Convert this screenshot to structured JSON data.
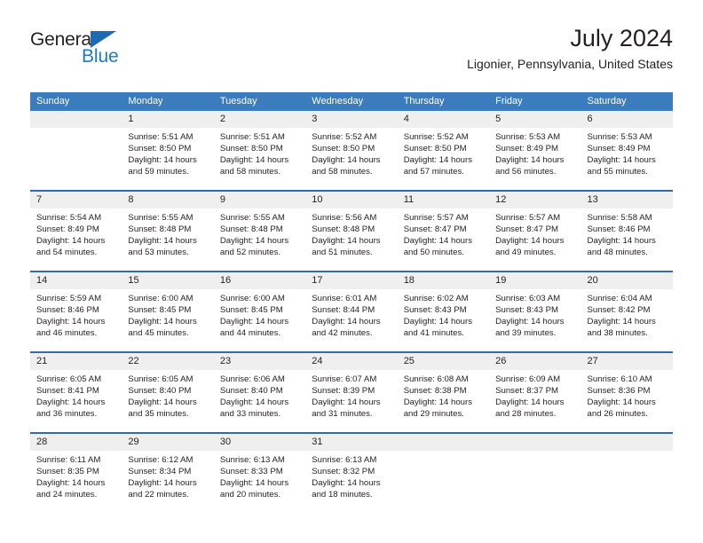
{
  "brand": {
    "name_top": "General",
    "name_bottom": "Blue",
    "color_dark": "#231f20",
    "color_blue": "#1f7ac4"
  },
  "header": {
    "title": "July 2024",
    "subtitle": "Ligonier, Pennsylvania, United States"
  },
  "theme": {
    "header_bg": "#3a7cbe",
    "header_text": "#ffffff",
    "daynum_bg": "#efefef",
    "separator": "#2f6ca8",
    "body_text": "#231f20"
  },
  "calendar": {
    "weekdays": [
      "Sunday",
      "Monday",
      "Tuesday",
      "Wednesday",
      "Thursday",
      "Friday",
      "Saturday"
    ],
    "weeks": [
      [
        {
          "day": "",
          "lines": []
        },
        {
          "day": "1",
          "lines": [
            "Sunrise: 5:51 AM",
            "Sunset: 8:50 PM",
            "Daylight: 14 hours",
            "and 59 minutes."
          ]
        },
        {
          "day": "2",
          "lines": [
            "Sunrise: 5:51 AM",
            "Sunset: 8:50 PM",
            "Daylight: 14 hours",
            "and 58 minutes."
          ]
        },
        {
          "day": "3",
          "lines": [
            "Sunrise: 5:52 AM",
            "Sunset: 8:50 PM",
            "Daylight: 14 hours",
            "and 58 minutes."
          ]
        },
        {
          "day": "4",
          "lines": [
            "Sunrise: 5:52 AM",
            "Sunset: 8:50 PM",
            "Daylight: 14 hours",
            "and 57 minutes."
          ]
        },
        {
          "day": "5",
          "lines": [
            "Sunrise: 5:53 AM",
            "Sunset: 8:49 PM",
            "Daylight: 14 hours",
            "and 56 minutes."
          ]
        },
        {
          "day": "6",
          "lines": [
            "Sunrise: 5:53 AM",
            "Sunset: 8:49 PM",
            "Daylight: 14 hours",
            "and 55 minutes."
          ]
        }
      ],
      [
        {
          "day": "7",
          "lines": [
            "Sunrise: 5:54 AM",
            "Sunset: 8:49 PM",
            "Daylight: 14 hours",
            "and 54 minutes."
          ]
        },
        {
          "day": "8",
          "lines": [
            "Sunrise: 5:55 AM",
            "Sunset: 8:48 PM",
            "Daylight: 14 hours",
            "and 53 minutes."
          ]
        },
        {
          "day": "9",
          "lines": [
            "Sunrise: 5:55 AM",
            "Sunset: 8:48 PM",
            "Daylight: 14 hours",
            "and 52 minutes."
          ]
        },
        {
          "day": "10",
          "lines": [
            "Sunrise: 5:56 AM",
            "Sunset: 8:48 PM",
            "Daylight: 14 hours",
            "and 51 minutes."
          ]
        },
        {
          "day": "11",
          "lines": [
            "Sunrise: 5:57 AM",
            "Sunset: 8:47 PM",
            "Daylight: 14 hours",
            "and 50 minutes."
          ]
        },
        {
          "day": "12",
          "lines": [
            "Sunrise: 5:57 AM",
            "Sunset: 8:47 PM",
            "Daylight: 14 hours",
            "and 49 minutes."
          ]
        },
        {
          "day": "13",
          "lines": [
            "Sunrise: 5:58 AM",
            "Sunset: 8:46 PM",
            "Daylight: 14 hours",
            "and 48 minutes."
          ]
        }
      ],
      [
        {
          "day": "14",
          "lines": [
            "Sunrise: 5:59 AM",
            "Sunset: 8:46 PM",
            "Daylight: 14 hours",
            "and 46 minutes."
          ]
        },
        {
          "day": "15",
          "lines": [
            "Sunrise: 6:00 AM",
            "Sunset: 8:45 PM",
            "Daylight: 14 hours",
            "and 45 minutes."
          ]
        },
        {
          "day": "16",
          "lines": [
            "Sunrise: 6:00 AM",
            "Sunset: 8:45 PM",
            "Daylight: 14 hours",
            "and 44 minutes."
          ]
        },
        {
          "day": "17",
          "lines": [
            "Sunrise: 6:01 AM",
            "Sunset: 8:44 PM",
            "Daylight: 14 hours",
            "and 42 minutes."
          ]
        },
        {
          "day": "18",
          "lines": [
            "Sunrise: 6:02 AM",
            "Sunset: 8:43 PM",
            "Daylight: 14 hours",
            "and 41 minutes."
          ]
        },
        {
          "day": "19",
          "lines": [
            "Sunrise: 6:03 AM",
            "Sunset: 8:43 PM",
            "Daylight: 14 hours",
            "and 39 minutes."
          ]
        },
        {
          "day": "20",
          "lines": [
            "Sunrise: 6:04 AM",
            "Sunset: 8:42 PM",
            "Daylight: 14 hours",
            "and 38 minutes."
          ]
        }
      ],
      [
        {
          "day": "21",
          "lines": [
            "Sunrise: 6:05 AM",
            "Sunset: 8:41 PM",
            "Daylight: 14 hours",
            "and 36 minutes."
          ]
        },
        {
          "day": "22",
          "lines": [
            "Sunrise: 6:05 AM",
            "Sunset: 8:40 PM",
            "Daylight: 14 hours",
            "and 35 minutes."
          ]
        },
        {
          "day": "23",
          "lines": [
            "Sunrise: 6:06 AM",
            "Sunset: 8:40 PM",
            "Daylight: 14 hours",
            "and 33 minutes."
          ]
        },
        {
          "day": "24",
          "lines": [
            "Sunrise: 6:07 AM",
            "Sunset: 8:39 PM",
            "Daylight: 14 hours",
            "and 31 minutes."
          ]
        },
        {
          "day": "25",
          "lines": [
            "Sunrise: 6:08 AM",
            "Sunset: 8:38 PM",
            "Daylight: 14 hours",
            "and 29 minutes."
          ]
        },
        {
          "day": "26",
          "lines": [
            "Sunrise: 6:09 AM",
            "Sunset: 8:37 PM",
            "Daylight: 14 hours",
            "and 28 minutes."
          ]
        },
        {
          "day": "27",
          "lines": [
            "Sunrise: 6:10 AM",
            "Sunset: 8:36 PM",
            "Daylight: 14 hours",
            "and 26 minutes."
          ]
        }
      ],
      [
        {
          "day": "28",
          "lines": [
            "Sunrise: 6:11 AM",
            "Sunset: 8:35 PM",
            "Daylight: 14 hours",
            "and 24 minutes."
          ]
        },
        {
          "day": "29",
          "lines": [
            "Sunrise: 6:12 AM",
            "Sunset: 8:34 PM",
            "Daylight: 14 hours",
            "and 22 minutes."
          ]
        },
        {
          "day": "30",
          "lines": [
            "Sunrise: 6:13 AM",
            "Sunset: 8:33 PM",
            "Daylight: 14 hours",
            "and 20 minutes."
          ]
        },
        {
          "day": "31",
          "lines": [
            "Sunrise: 6:13 AM",
            "Sunset: 8:32 PM",
            "Daylight: 14 hours",
            "and 18 minutes."
          ]
        },
        {
          "day": "",
          "lines": []
        },
        {
          "day": "",
          "lines": []
        },
        {
          "day": "",
          "lines": []
        }
      ]
    ]
  }
}
